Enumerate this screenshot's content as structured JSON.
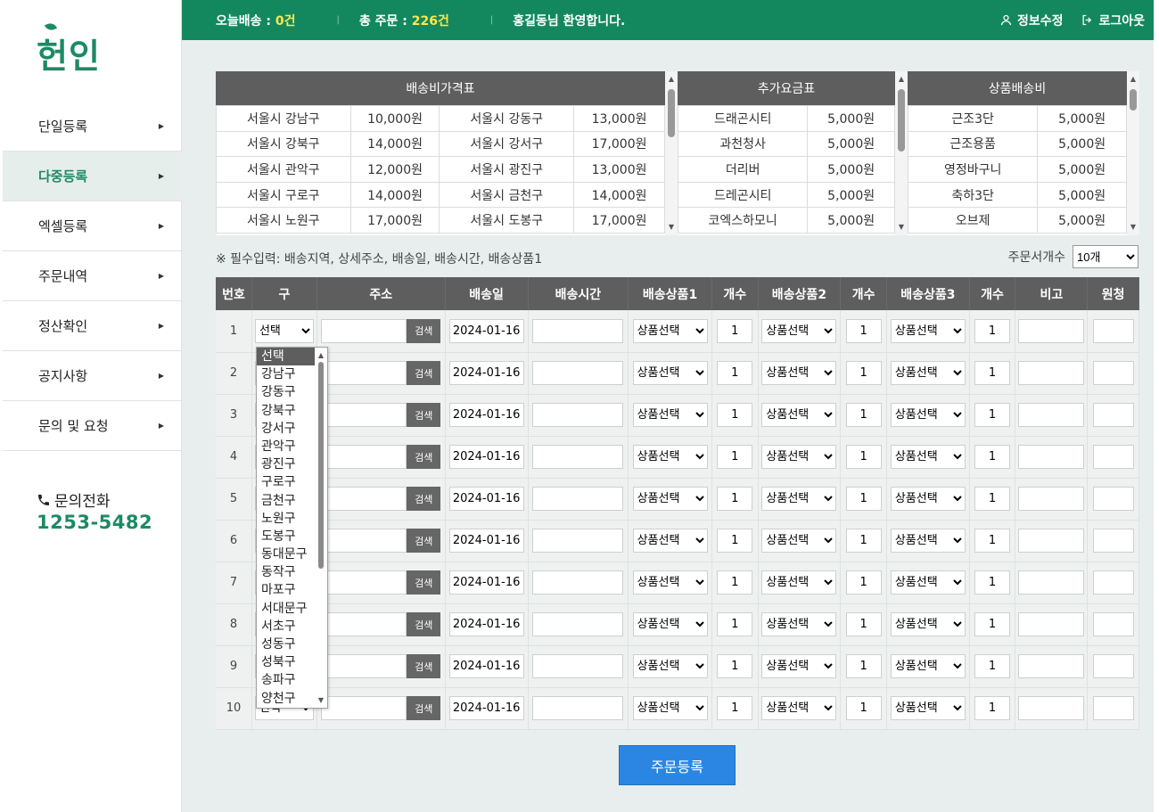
{
  "brand": {
    "logo": "헌인"
  },
  "sidebar": {
    "items": [
      {
        "label": "단일등록"
      },
      {
        "label": "다중등록"
      },
      {
        "label": "엑셀등록"
      },
      {
        "label": "주문내역"
      },
      {
        "label": "정산확인"
      },
      {
        "label": "공지사항"
      },
      {
        "label": "문의 및 요청"
      }
    ],
    "active_index": 1,
    "contact_label": "문의전화",
    "contact_number": "1253-5482"
  },
  "topbar": {
    "today_label": "오늘배송 : ",
    "today_value": "0건",
    "total_label": "총 주문 : ",
    "total_value": "226건",
    "welcome": "홍길동님 환영합니다.",
    "profile": "정보수정",
    "logout": "로그아웃"
  },
  "price_table": {
    "title": "배송비가격표",
    "rows": [
      [
        "서울시 강남구",
        "10,000원",
        "서울시 강동구",
        "13,000원"
      ],
      [
        "서울시 강북구",
        "14,000원",
        "서울시 강서구",
        "17,000원"
      ],
      [
        "서울시 관악구",
        "12,000원",
        "서울시 광진구",
        "13,000원"
      ],
      [
        "서울시 구로구",
        "14,000원",
        "서울시 금천구",
        "14,000원"
      ],
      [
        "서울시 노원구",
        "17,000원",
        "서울시 도봉구",
        "17,000원"
      ]
    ]
  },
  "extra_table": {
    "title": "추가요금표",
    "rows": [
      [
        "드래곤시티",
        "5,000원"
      ],
      [
        "과천청사",
        "5,000원"
      ],
      [
        "더리버",
        "5,000원"
      ],
      [
        "드레곤시티",
        "5,000원"
      ],
      [
        "코엑스하모니",
        "5,000원"
      ]
    ]
  },
  "product_table": {
    "title": "상품배송비",
    "rows": [
      [
        "근조3단",
        "5,000원"
      ],
      [
        "근조용품",
        "5,000원"
      ],
      [
        "영정바구니",
        "5,000원"
      ],
      [
        "축하3단",
        "5,000원"
      ],
      [
        "오브제",
        "5,000원"
      ]
    ]
  },
  "notice": "※ 필수입력: 배송지역, 상세주소, 배송일, 배송시간, 배송상품1",
  "order_count": {
    "label": "주문서개수",
    "value": "10개"
  },
  "order_table": {
    "headers": [
      "번호",
      "구",
      "주소",
      "배송일",
      "배송시간",
      "배송상품1",
      "개수",
      "배송상품2",
      "개수",
      "배송상품3",
      "개수",
      "비고",
      "원청"
    ],
    "rows": [
      {
        "no": "1",
        "gu": "선택",
        "date": "2024-01-16",
        "p1": "상품선택",
        "q1": "1",
        "p2": "상품선택",
        "q2": "1",
        "p3": "상품선택",
        "q3": "1"
      },
      {
        "no": "2",
        "gu": "선택",
        "date": "2024-01-16",
        "p1": "상품선택",
        "q1": "1",
        "p2": "상품선택",
        "q2": "1",
        "p3": "상품선택",
        "q3": "1"
      },
      {
        "no": "3",
        "gu": "선택",
        "date": "2024-01-16",
        "p1": "상품선택",
        "q1": "1",
        "p2": "상품선택",
        "q2": "1",
        "p3": "상품선택",
        "q3": "1"
      },
      {
        "no": "4",
        "gu": "선택",
        "date": "2024-01-16",
        "p1": "상품선택",
        "q1": "1",
        "p2": "상품선택",
        "q2": "1",
        "p3": "상품선택",
        "q3": "1"
      },
      {
        "no": "5",
        "gu": "선택",
        "date": "2024-01-16",
        "p1": "상품선택",
        "q1": "1",
        "p2": "상품선택",
        "q2": "1",
        "p3": "상품선택",
        "q3": "1"
      },
      {
        "no": "6",
        "gu": "선택",
        "date": "2024-01-16",
        "p1": "상품선택",
        "q1": "1",
        "p2": "상품선택",
        "q2": "1",
        "p3": "상품선택",
        "q3": "1"
      },
      {
        "no": "7",
        "gu": "선택",
        "date": "2024-01-16",
        "p1": "상품선택",
        "q1": "1",
        "p2": "상품선택",
        "q2": "1",
        "p3": "상품선택",
        "q3": "1"
      },
      {
        "no": "8",
        "gu": "선택",
        "date": "2024-01-16",
        "p1": "상품선택",
        "q1": "1",
        "p2": "상품선택",
        "q2": "1",
        "p3": "상품선택",
        "q3": "1"
      },
      {
        "no": "9",
        "gu": "선택",
        "date": "2024-01-16",
        "p1": "상품선택",
        "q1": "1",
        "p2": "상품선택",
        "q2": "1",
        "p3": "상품선택",
        "q3": "1"
      },
      {
        "no": "10",
        "gu": "선택",
        "date": "2024-01-16",
        "p1": "상품선택",
        "q1": "1",
        "p2": "상품선택",
        "q2": "1",
        "p3": "상품선택",
        "q3": "1"
      }
    ],
    "search_label": "검색"
  },
  "dropdown": {
    "options": [
      "선택",
      "강남구",
      "강동구",
      "강북구",
      "강서구",
      "관악구",
      "광진구",
      "구로구",
      "금천구",
      "노원구",
      "도봉구",
      "동대문구",
      "동작구",
      "마포구",
      "서대문구",
      "서초구",
      "성동구",
      "성북구",
      "송파구",
      "양천구"
    ],
    "selected_index": 0
  },
  "submit_label": "주문등록",
  "colors": {
    "brand": "#13885f",
    "accent_yellow": "#ffe74a",
    "header_gray": "#5e5e5e",
    "submit_blue": "#2b86e3"
  }
}
